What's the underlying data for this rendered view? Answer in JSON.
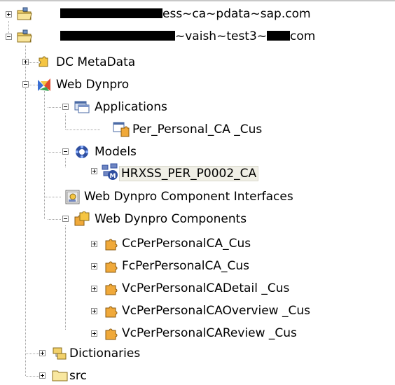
{
  "tree": {
    "nodes": [
      {
        "id": "project-1",
        "text_visible": "ess~ca~pdata~sap.com",
        "expander": "+"
      },
      {
        "id": "project-2",
        "text_visible_a": "~vaish~test3~",
        "text_visible_b": "com",
        "expander": "−"
      },
      {
        "id": "dc-metadata",
        "label": "DC MetaData",
        "expander": "+"
      },
      {
        "id": "web-dynpro",
        "label": "Web Dynpro",
        "expander": "−"
      },
      {
        "id": "applications",
        "label": "Applications",
        "expander": "−"
      },
      {
        "id": "app-per-personal",
        "label": "Per_Personal_CA _Cus"
      },
      {
        "id": "models",
        "label": "Models",
        "expander": "−"
      },
      {
        "id": "model-hrxss",
        "label": "HRXSS_PER_P0002_CA",
        "expander": "+",
        "selected": true
      },
      {
        "id": "component-interfaces",
        "label": "Web Dynpro Component Interfaces"
      },
      {
        "id": "components",
        "label": "Web Dynpro Components",
        "expander": "−"
      },
      {
        "id": "comp-cc",
        "label": "CcPerPersonalCA_Cus",
        "expander": "+"
      },
      {
        "id": "comp-fc",
        "label": "FcPerPersonalCA_Cus",
        "expander": "+"
      },
      {
        "id": "comp-vc-detail",
        "label": "VcPerPersonalCADetail _Cus",
        "expander": "+"
      },
      {
        "id": "comp-vc-overview",
        "label": "VcPerPersonalCAOverview _Cus",
        "expander": "+"
      },
      {
        "id": "comp-vc-review",
        "label": "VcPerPersonalCAReview _Cus",
        "expander": "+"
      },
      {
        "id": "dictionaries",
        "label": "Dictionaries",
        "expander": "+"
      },
      {
        "id": "src",
        "label": "src",
        "expander": "+"
      }
    ]
  },
  "icons": {
    "project": "folder-project-icon",
    "dc-metadata": "metadata-puzzle-icon",
    "web-dynpro": "web-dynpro-icon",
    "applications": "applications-icon",
    "application": "application-window-icon",
    "models": "models-icon",
    "model": "model-icon",
    "component-interfaces": "component-interface-icon",
    "components": "components-icon",
    "component": "component-puzzle-icon",
    "dictionaries": "dictionaries-icon",
    "src": "folder-icon"
  },
  "colors": {
    "tree_lines": "#a0a0a0",
    "selection_bg": "#f0efe6",
    "folder_yellow": "#f2d16b",
    "puzzle_orange": "#f0a93a"
  }
}
